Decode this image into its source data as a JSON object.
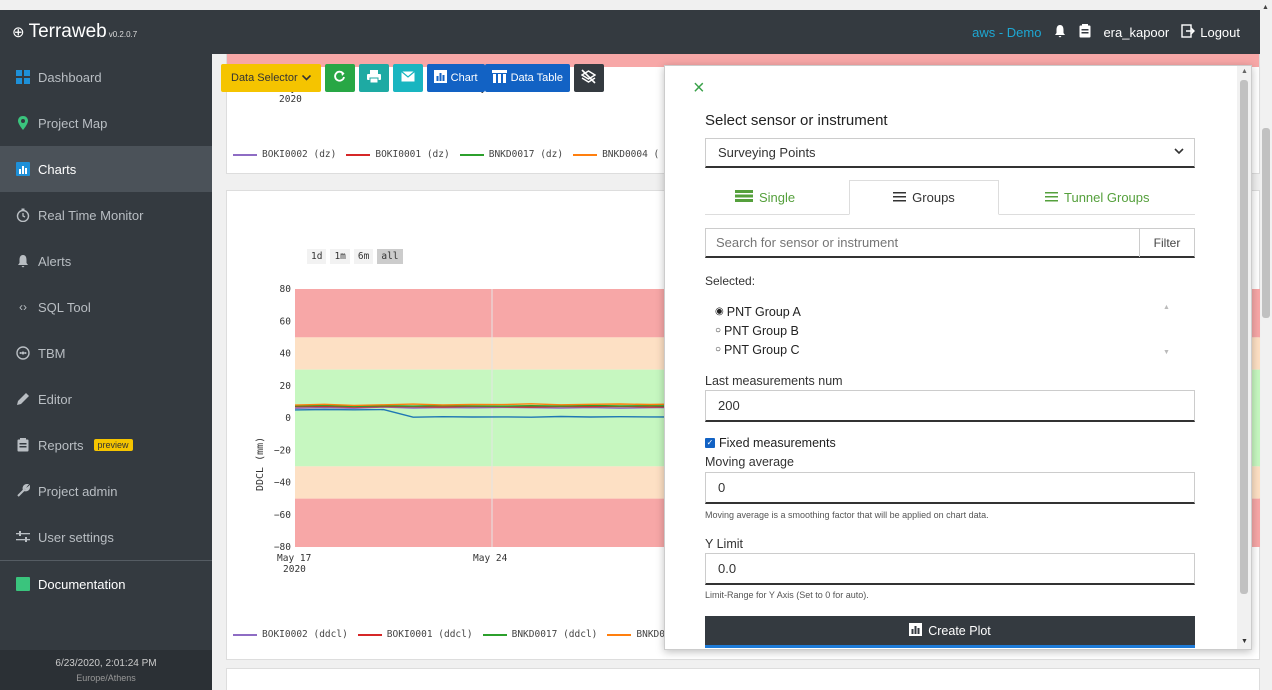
{
  "app": {
    "brand": "Terraweb",
    "version": "v0.2.0.7",
    "env": "aws - Demo",
    "user": "era_kapoor",
    "logout": "Logout"
  },
  "sidebar": {
    "items": [
      {
        "label": "Dashboard",
        "icon": "dashboard-icon"
      },
      {
        "label": "Project Map",
        "icon": "map-pin-icon"
      },
      {
        "label": "Charts",
        "icon": "chart-icon",
        "active": true
      },
      {
        "label": "Real Time Monitor",
        "icon": "timer-icon"
      },
      {
        "label": "Alerts",
        "icon": "bell-icon"
      },
      {
        "label": "SQL Tool",
        "icon": "code-icon"
      },
      {
        "label": "TBM",
        "icon": "tbm-icon"
      },
      {
        "label": "Editor",
        "icon": "pencil-icon"
      },
      {
        "label": "Reports",
        "icon": "clipboard-icon",
        "badge": "preview"
      },
      {
        "label": "Project admin",
        "icon": "wrench-icon"
      },
      {
        "label": "User settings",
        "icon": "sliders-icon"
      },
      {
        "label": "Documentation",
        "icon": "book-icon"
      }
    ],
    "footer_time": "6/23/2020, 2:01:24 PM",
    "footer_tz": "Europe/Athens"
  },
  "toolbar": {
    "data_selector": "Data Selector",
    "chart": "Chart",
    "data_table": "Data Table"
  },
  "chart1": {
    "ticks": {
      "may17": "May 17",
      "year": "2020",
      "may24": "May 24"
    },
    "legend": [
      "BOKI0002 (dz)",
      "BOKI0001 (dz)",
      "BNKD0017 (dz)",
      "BNKD0004 ("
    ]
  },
  "colors": {
    "s1": "#8e6cc4",
    "s2": "#d62728",
    "s3": "#2ca02c",
    "s4": "#ff7f0e",
    "s5": "#1f77b4",
    "s6": "#2a9d8f",
    "red_band": "#f7a7a7",
    "orange_band": "#fde0c4",
    "green_band": "#c6f7c0",
    "accent_green": "#3aa14a"
  },
  "chart_data": {
    "type": "line",
    "title": "",
    "xlabel": "",
    "ylabel": "DDCL (mm)",
    "ylim": [
      -80,
      80
    ],
    "yticks": [
      "80",
      "60",
      "40",
      "20",
      "0",
      "−20",
      "−40",
      "−60",
      "−80"
    ],
    "xtick_labels": [
      "May 17\n2020",
      "May 24"
    ],
    "range_buttons": [
      "1d",
      "1m",
      "6m",
      "all"
    ],
    "bands": [
      {
        "from": 50,
        "to": 80,
        "color": "#f7a7a7"
      },
      {
        "from": 30,
        "to": 50,
        "color": "#fde0c4"
      },
      {
        "from": -30,
        "to": 30,
        "color": "#c6f7c0"
      },
      {
        "from": -50,
        "to": -30,
        "color": "#fde0c4"
      },
      {
        "from": -80,
        "to": -50,
        "color": "#f7a7a7"
      }
    ],
    "series": [
      {
        "name": "BOKI0002 (ddcl)",
        "color": "#8e6cc4",
        "values": [
          6,
          6.5,
          6,
          6.8,
          6.2,
          6.5,
          6.3,
          6.6,
          6.4,
          6.2,
          6.5,
          6.1,
          6.4,
          6.6
        ]
      },
      {
        "name": "BOKI0001 (ddcl)",
        "color": "#d62728",
        "values": [
          7,
          7.2,
          6.8,
          7.1,
          7,
          6.9,
          7.2,
          7,
          6.8,
          7.1,
          7,
          7.2,
          6.9,
          7
        ]
      },
      {
        "name": "BNKD0017 (ddcl)",
        "color": "#2ca02c",
        "values": [
          7.5,
          7.8,
          7.2,
          7.6,
          7.4,
          7.7,
          7.5,
          7.3,
          7.6,
          7.4,
          7.8,
          7.5,
          7.6,
          7.4
        ]
      },
      {
        "name": "BNKD0",
        "color": "#ff7f0e",
        "values": [
          8,
          8.5,
          7.8,
          8.2,
          8.6,
          8.1,
          8.4,
          8.3,
          8.8,
          8.2,
          8.5,
          8.7,
          8.4,
          8.6
        ]
      },
      {
        "name": "",
        "color": "#1f77b4",
        "values": [
          5,
          5.3,
          5.1,
          5.2,
          0.5,
          0.8,
          0.6,
          0.7,
          0.5,
          0.9,
          0.6,
          0.8,
          0.7,
          0.6
        ]
      }
    ]
  },
  "modal": {
    "title": "Select sensor or instrument",
    "select_value": "Surveying Points",
    "tabs": [
      "Single",
      "Groups",
      "Tunnel Groups"
    ],
    "search_placeholder": "Search for sensor or instrument",
    "filter": "Filter",
    "selected_label": "Selected:",
    "groups": [
      "PNT Group A",
      "PNT Group B",
      "PNT Group C"
    ],
    "last_meas_label": "Last measurements num",
    "last_meas_value": "200",
    "fixed_label": "Fixed measurements",
    "moving_avg_label": "Moving average",
    "moving_avg_value": "0",
    "moving_avg_help": "Moving average is a smoothing factor that will be applied on chart data.",
    "ylimit_label": "Y Limit",
    "ylimit_value": "0.0",
    "ylimit_help": "Limit-Range for Y Axis (Set to 0 for auto).",
    "create_btn": "Create Plot"
  }
}
